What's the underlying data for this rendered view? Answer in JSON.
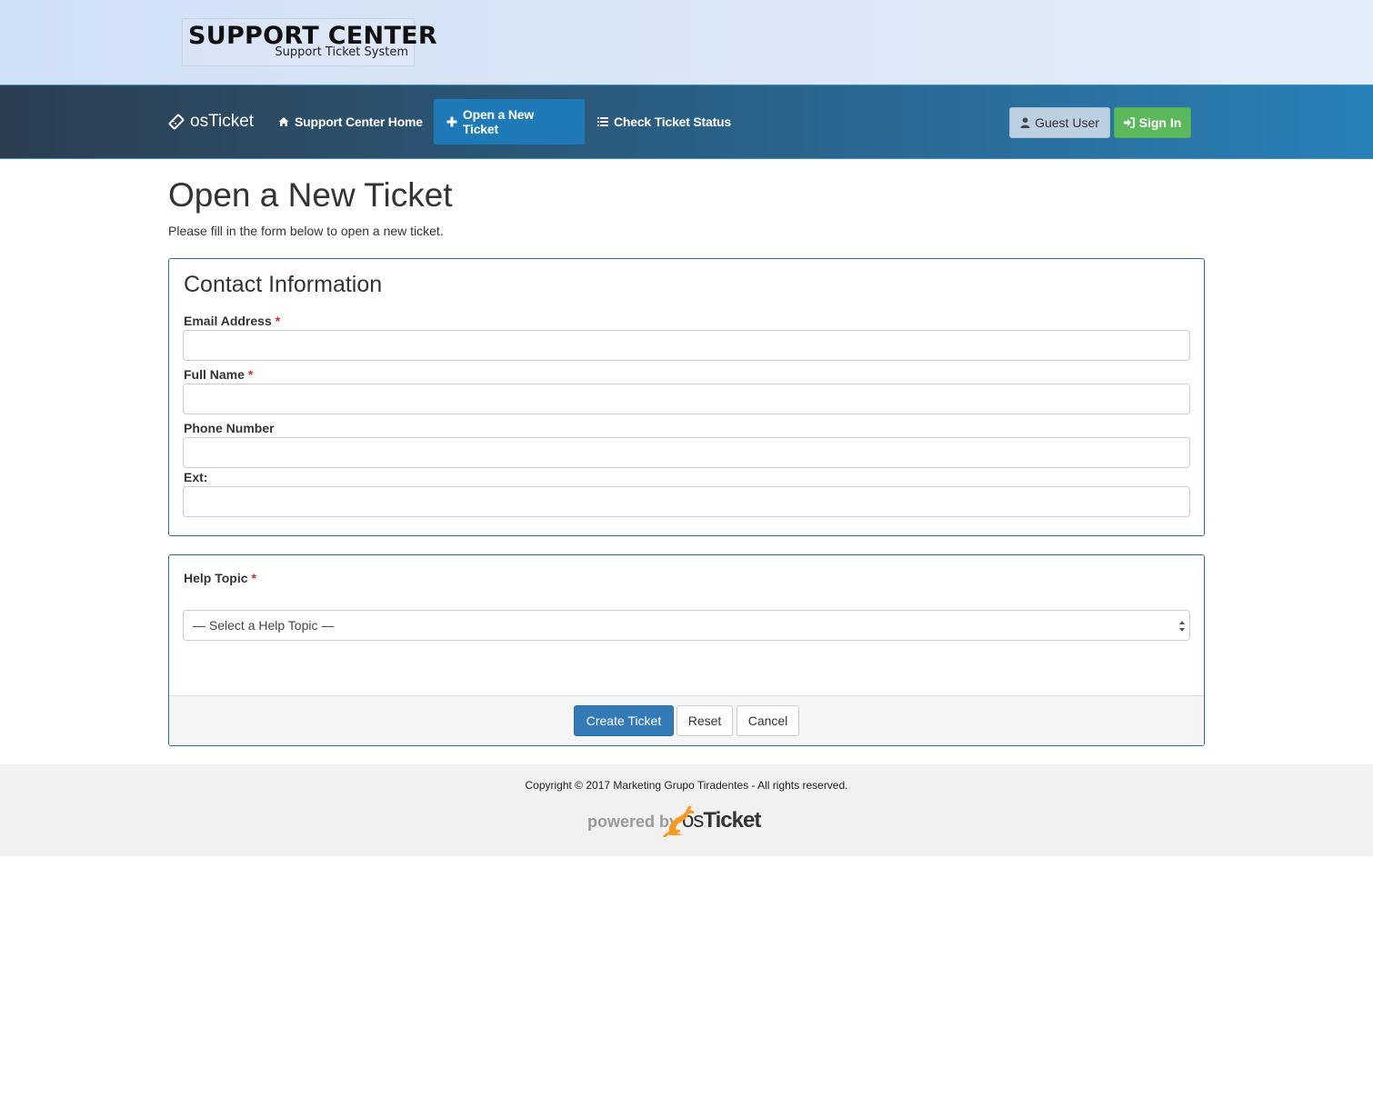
{
  "header": {
    "logo_title": "SUPPORT CENTER",
    "logo_subtitle": "Support Ticket System"
  },
  "nav": {
    "brand": "osTicket",
    "items": [
      {
        "label": "Support Center Home",
        "icon": "home-icon"
      },
      {
        "label": "Open a New Ticket",
        "icon": "plus-icon",
        "active": true
      },
      {
        "label": "Check Ticket Status",
        "icon": "list-icon"
      }
    ],
    "guest_label": "Guest User",
    "signin_label": "Sign In"
  },
  "page": {
    "title": "Open a New Ticket",
    "intro": "Please fill in the form below to open a new ticket."
  },
  "contact": {
    "section_title": "Contact Information",
    "fields": [
      {
        "label": "Email Address",
        "required": true,
        "value": ""
      },
      {
        "label": "Full Name",
        "required": true,
        "value": ""
      },
      {
        "label": "Phone Number",
        "required": false,
        "value": ""
      },
      {
        "label": "Ext:",
        "required": false,
        "value": ""
      }
    ],
    "required_mark": "*"
  },
  "topic": {
    "label": "Help Topic",
    "required_mark": "*",
    "selected": "— Select a Help Topic —"
  },
  "actions": {
    "create_label": "Create Ticket",
    "reset_label": "Reset",
    "cancel_label": "Cancel"
  },
  "footer": {
    "copyright": "Copyright © 2017 Marketing Grupo Tiradentes - All rights reserved.",
    "powered_by": "powered by",
    "powered_brand_os": "os",
    "powered_brand_ticket": "Ticket"
  },
  "colors": {
    "primary": "#337ab7",
    "success": "#5cb85c",
    "required": "#c9302c"
  }
}
